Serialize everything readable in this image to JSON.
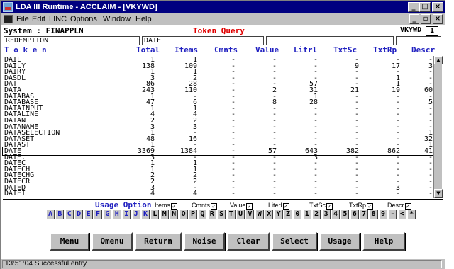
{
  "window": {
    "title": "LDA III Runtime - ACCLAIM - [VKYWD]",
    "minimize": "_",
    "maximize": "□",
    "close": "×"
  },
  "menu": {
    "items": [
      "File",
      "Edit",
      "LINC",
      "Options",
      "Window",
      "Help"
    ],
    "mdi_min": "_",
    "mdi_restore": "▫",
    "mdi_close": "×"
  },
  "screen": {
    "system_label": "System : FINAPPLN",
    "screen_title": "Token Query",
    "screen_id": "VKYWD",
    "page": "1",
    "field1": "REDEMPTION",
    "field2": "DATE",
    "field3": "",
    "field4": ""
  },
  "table": {
    "headers": [
      "T o k e n",
      "Total",
      "Items",
      "Cmnts",
      "Value",
      "Litrl",
      "TxtSc",
      "TxtRp",
      "Descr"
    ],
    "rows": [
      [
        "DAIL",
        "1",
        "1",
        "-",
        "-",
        "-",
        "-",
        "-",
        "-"
      ],
      [
        "DAILY",
        "138",
        "109",
        "-",
        "-",
        "-",
        "9",
        "17",
        "3"
      ],
      [
        "DAIRY",
        "1",
        "1",
        "-",
        "-",
        "-",
        "-",
        "-",
        "-"
      ],
      [
        "DASDL",
        "3",
        "2",
        "-",
        "-",
        "-",
        "-",
        "1",
        "-"
      ],
      [
        "DAT",
        "86",
        "28",
        "-",
        "-",
        "57",
        "-",
        "1",
        "-"
      ],
      [
        "DATA",
        "243",
        "110",
        "-",
        "2",
        "31",
        "21",
        "19",
        "60"
      ],
      [
        "DATABAS",
        "1",
        "-",
        "-",
        "-",
        "1",
        "-",
        "-",
        "-"
      ],
      [
        "DATABASE",
        "47",
        "6",
        "-",
        "8",
        "28",
        "-",
        "-",
        "5"
      ],
      [
        "DATAINPUT",
        "1",
        "1",
        "-",
        "-",
        "-",
        "-",
        "-",
        "-"
      ],
      [
        "DATALINE",
        "4",
        "4",
        "-",
        "-",
        "-",
        "-",
        "-",
        "-"
      ],
      [
        "DATAN",
        "2",
        "2",
        "-",
        "-",
        "-",
        "-",
        "-",
        "-"
      ],
      [
        "DATANAME",
        "3",
        "3",
        "-",
        "-",
        "-",
        "-",
        "-",
        "-"
      ],
      [
        "DATASELECTION",
        "1",
        "-",
        "-",
        "-",
        "-",
        "-",
        "-",
        "1"
      ],
      [
        "DATASET",
        "48",
        "16",
        "-",
        "-",
        "-",
        "-",
        "-",
        "32"
      ],
      [
        "DATAST",
        "1",
        "-",
        "-",
        "-",
        "-",
        "-",
        "-",
        "1"
      ],
      [
        "DATE",
        "3369",
        "1384",
        "-",
        "57",
        "643",
        "382",
        "862",
        "41"
      ],
      [
        "DATE.",
        "3",
        "-",
        "-",
        "-",
        "3",
        "-",
        "-",
        "-"
      ],
      [
        "DATEC",
        "1",
        "1",
        "-",
        "-",
        "-",
        "-",
        "-",
        "-"
      ],
      [
        "DATECH",
        "1",
        "1",
        "-",
        "-",
        "-",
        "-",
        "-",
        "-"
      ],
      [
        "DATECHG",
        "2",
        "2",
        "-",
        "-",
        "-",
        "-",
        "-",
        "-"
      ],
      [
        "DATECR",
        "2",
        "2",
        "-",
        "-",
        "-",
        "-",
        "-",
        "-"
      ],
      [
        "DATED",
        "3",
        "-",
        "-",
        "-",
        "-",
        "-",
        "3",
        "-"
      ],
      [
        "DATEI",
        "4",
        "4",
        "-",
        "-",
        "-",
        "-",
        "-",
        "-"
      ]
    ],
    "selected_index": 15
  },
  "usage": {
    "label": "Usage Option",
    "options": [
      "Items",
      "Cmnts",
      "Value",
      "Literl",
      "TxtSc",
      "TxtRp",
      "Descr"
    ],
    "check": "✓"
  },
  "alphabet": [
    "A",
    "B",
    "C",
    "D",
    "E",
    "F",
    "G",
    "H",
    "I",
    "J",
    "K",
    "L",
    "M",
    "N",
    "O",
    "P",
    "Q",
    "R",
    "S",
    "T",
    "U",
    "V",
    "W",
    "X",
    "Y",
    "Z",
    "0",
    "1",
    "2",
    "3",
    "4",
    "5",
    "6",
    "7",
    "8",
    "9",
    "-",
    "<",
    "*"
  ],
  "buttons": [
    "Menu",
    "Qmenu",
    "Return",
    "Noise",
    "Clear",
    "Select",
    "Usage",
    "Help"
  ],
  "status": "13:51:04 Successful entry"
}
